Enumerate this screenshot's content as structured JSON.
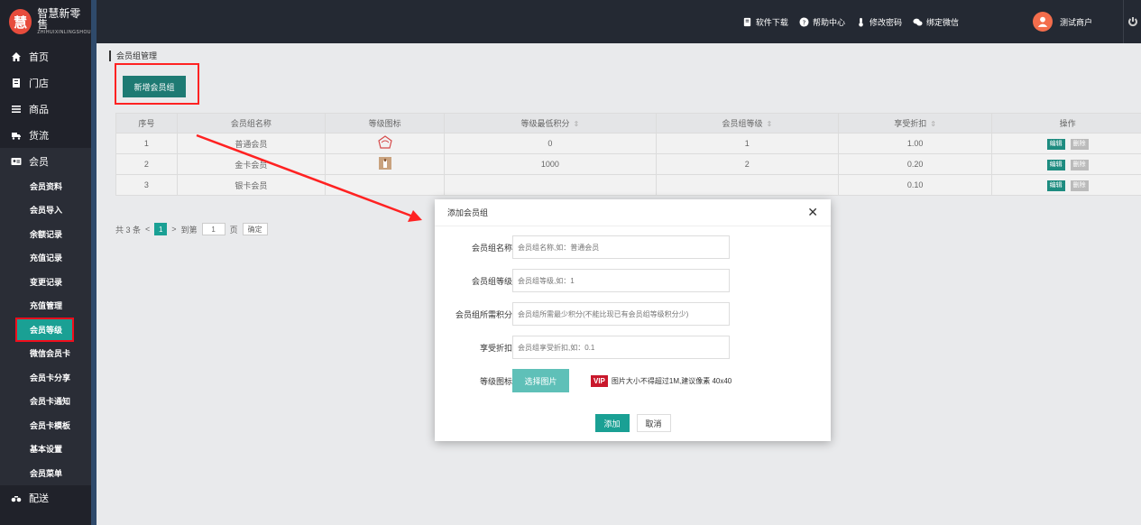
{
  "brand": {
    "badge": "慧",
    "name": "智慧新零售",
    "sub": "ZHIHUIXINLINGSHOU"
  },
  "topbar": {
    "download": "软件下载",
    "help": "帮助中心",
    "password": "修改密码",
    "wechat": "绑定微信",
    "user": "测试商户"
  },
  "sidebar": {
    "items": [
      {
        "label": "首页",
        "icon": "home-icon"
      },
      {
        "label": "门店",
        "icon": "store-icon"
      },
      {
        "label": "商品",
        "icon": "list-icon"
      },
      {
        "label": "货流",
        "icon": "truck-icon"
      },
      {
        "label": "会员",
        "icon": "member-card-icon"
      }
    ],
    "member_sub": [
      "会员资料",
      "会员导入",
      "余额记录",
      "充值记录",
      "变更记录",
      "充值管理",
      "会员等级",
      "微信会员卡",
      "会员卡分享",
      "会员卡通知",
      "会员卡模板",
      "基本设置",
      "会员菜单"
    ],
    "bottom": {
      "label": "配送",
      "icon": "bike-icon"
    }
  },
  "page": {
    "breadcrumb": "会员组管理",
    "add_button": "新增会员组"
  },
  "table": {
    "headers": [
      "序号",
      "会员组名称",
      "等级图标",
      "等级最低积分",
      "会员组等级",
      "享受折扣",
      "操作"
    ],
    "edit_label": "编辑",
    "delete_label": "删除",
    "rows": [
      {
        "no": "1",
        "name": "普通会员",
        "points": "0",
        "level": "1",
        "discount": "1.00"
      },
      {
        "no": "2",
        "name": "金卡会员",
        "points": "1000",
        "level": "2",
        "discount": "0.20"
      },
      {
        "no": "3",
        "name": "银卡会员",
        "points": "",
        "level": "",
        "discount": "0.10"
      }
    ]
  },
  "pager": {
    "total": "共 3 条",
    "current": "1",
    "goto": "到第",
    "page_input": "1",
    "page_unit": "页",
    "confirm": "确定"
  },
  "modal": {
    "title": "添加会员组",
    "fields": [
      {
        "label": "会员组名称",
        "placeholder": "会员组名称,如：普通会员"
      },
      {
        "label": "会员组等级",
        "placeholder": "会员组等级,如：1"
      },
      {
        "label": "会员组所需积分",
        "placeholder": "会员组所需最少积分(不能比现已有会员组等级积分少)"
      },
      {
        "label": "享受折扣",
        "placeholder": "会员组享受折扣,如：0.1"
      }
    ],
    "icon_label": "等级图标",
    "choose_button": "选择图片",
    "vip_badge": "VIP",
    "hint": "图片大小不得超过1M,建议像素 40x40",
    "ok": "添加",
    "cancel": "取消"
  },
  "colors": {
    "accent": "#1aa094",
    "highlight": "#f22222",
    "sidebar": "#20222a"
  }
}
